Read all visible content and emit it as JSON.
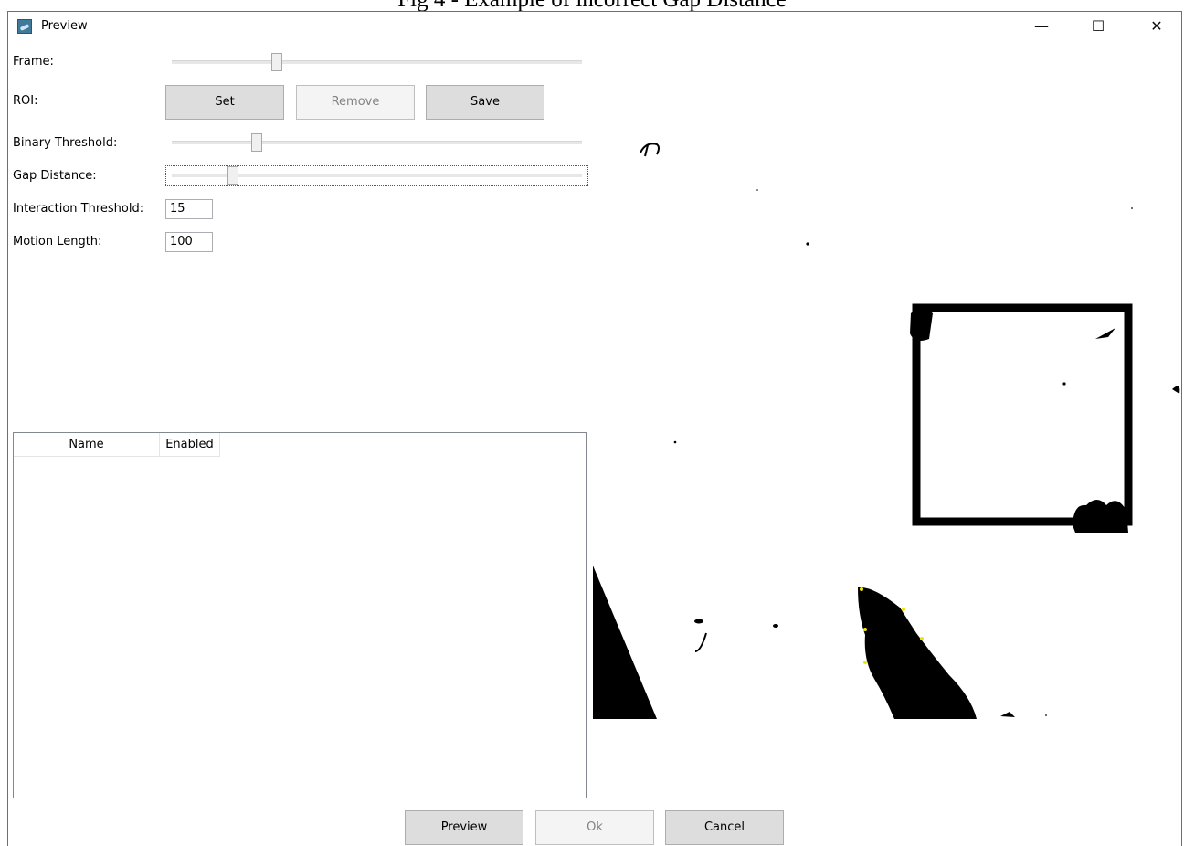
{
  "caption": "Fig 4 - Example of incorrect Gap Distance",
  "window": {
    "title": "Preview",
    "controls": {
      "minimize": "—",
      "maximize": "☐",
      "close": "✕"
    }
  },
  "form": {
    "frame_label": "Frame:",
    "frame_value": 0.25,
    "roi_label": "ROI:",
    "roi_buttons": {
      "set": "Set",
      "remove": "Remove",
      "save": "Save"
    },
    "binary_threshold_label": "Binary Threshold:",
    "binary_threshold_value": 0.2,
    "gap_distance_label": "Gap Distance:",
    "gap_distance_value": 0.14,
    "interaction_threshold_label": "Interaction Threshold:",
    "interaction_threshold_value": "15",
    "motion_length_label": "Motion Length:",
    "motion_length_value": "100"
  },
  "grid": {
    "columns": [
      "Name",
      "Enabled"
    ],
    "rows": []
  },
  "footer": {
    "preview": "Preview",
    "ok": "Ok",
    "cancel": "Cancel"
  },
  "colors": {
    "window_border": "#2d7dd2",
    "button_bg": "#dddddd",
    "marker": "#f2e600"
  }
}
